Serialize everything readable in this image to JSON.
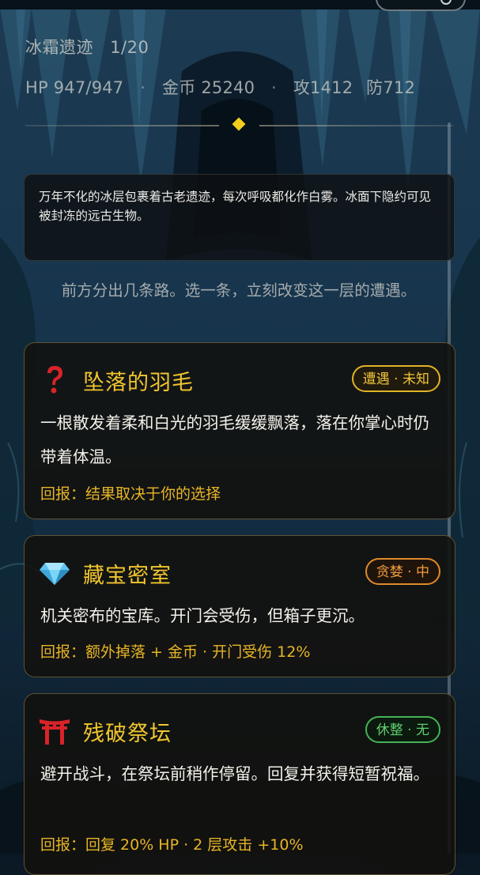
{
  "header": {
    "floor_name": "冰霜遗迹",
    "floor_progress": "1/20",
    "hp": "HP 947/947",
    "gold": "金币 25240",
    "attack": "攻1412",
    "defense": "防712",
    "separator": "·"
  },
  "description": "万年不化的冰层包裹着古老遗迹，每次呼吸都化作白雾。冰面下隐约可见被封冻的远古生物。",
  "prompt": "前方分出几条路。选一条，立刻改变这一层的遭遇。",
  "choices": [
    {
      "icon": "question-mark-icon",
      "title": "坠落的羽毛",
      "tag": "遭遇 · 未知",
      "tag_color": "#e1b327",
      "description": "一根散发着柔和白光的羽毛缓缓飘落，落在你掌心时仍带着体温。",
      "reward": "回报：结果取决于你的选择"
    },
    {
      "icon": "gem-icon",
      "title": "藏宝密室",
      "tag": "贪婪 · 中",
      "tag_color": "#e08a2b",
      "description": "机关密布的宝库。开门会受伤，但箱子更沉。",
      "reward": "回报：额外掉落 + 金币 · 开门受伤 12%"
    },
    {
      "icon": "torii-gate-icon",
      "title": "残破祭坛",
      "tag": "休整 · 无",
      "tag_color": "#45b357",
      "description": "避开战斗，在祭坛前稍作停留。回复并获得短暂祝福。",
      "reward": "回报：回复 20% HP · 2 层攻击 +10%"
    }
  ],
  "colors": {
    "accent": "#f1c52e",
    "diamond": "#f3cf1c",
    "card_bg": "#12110e"
  }
}
